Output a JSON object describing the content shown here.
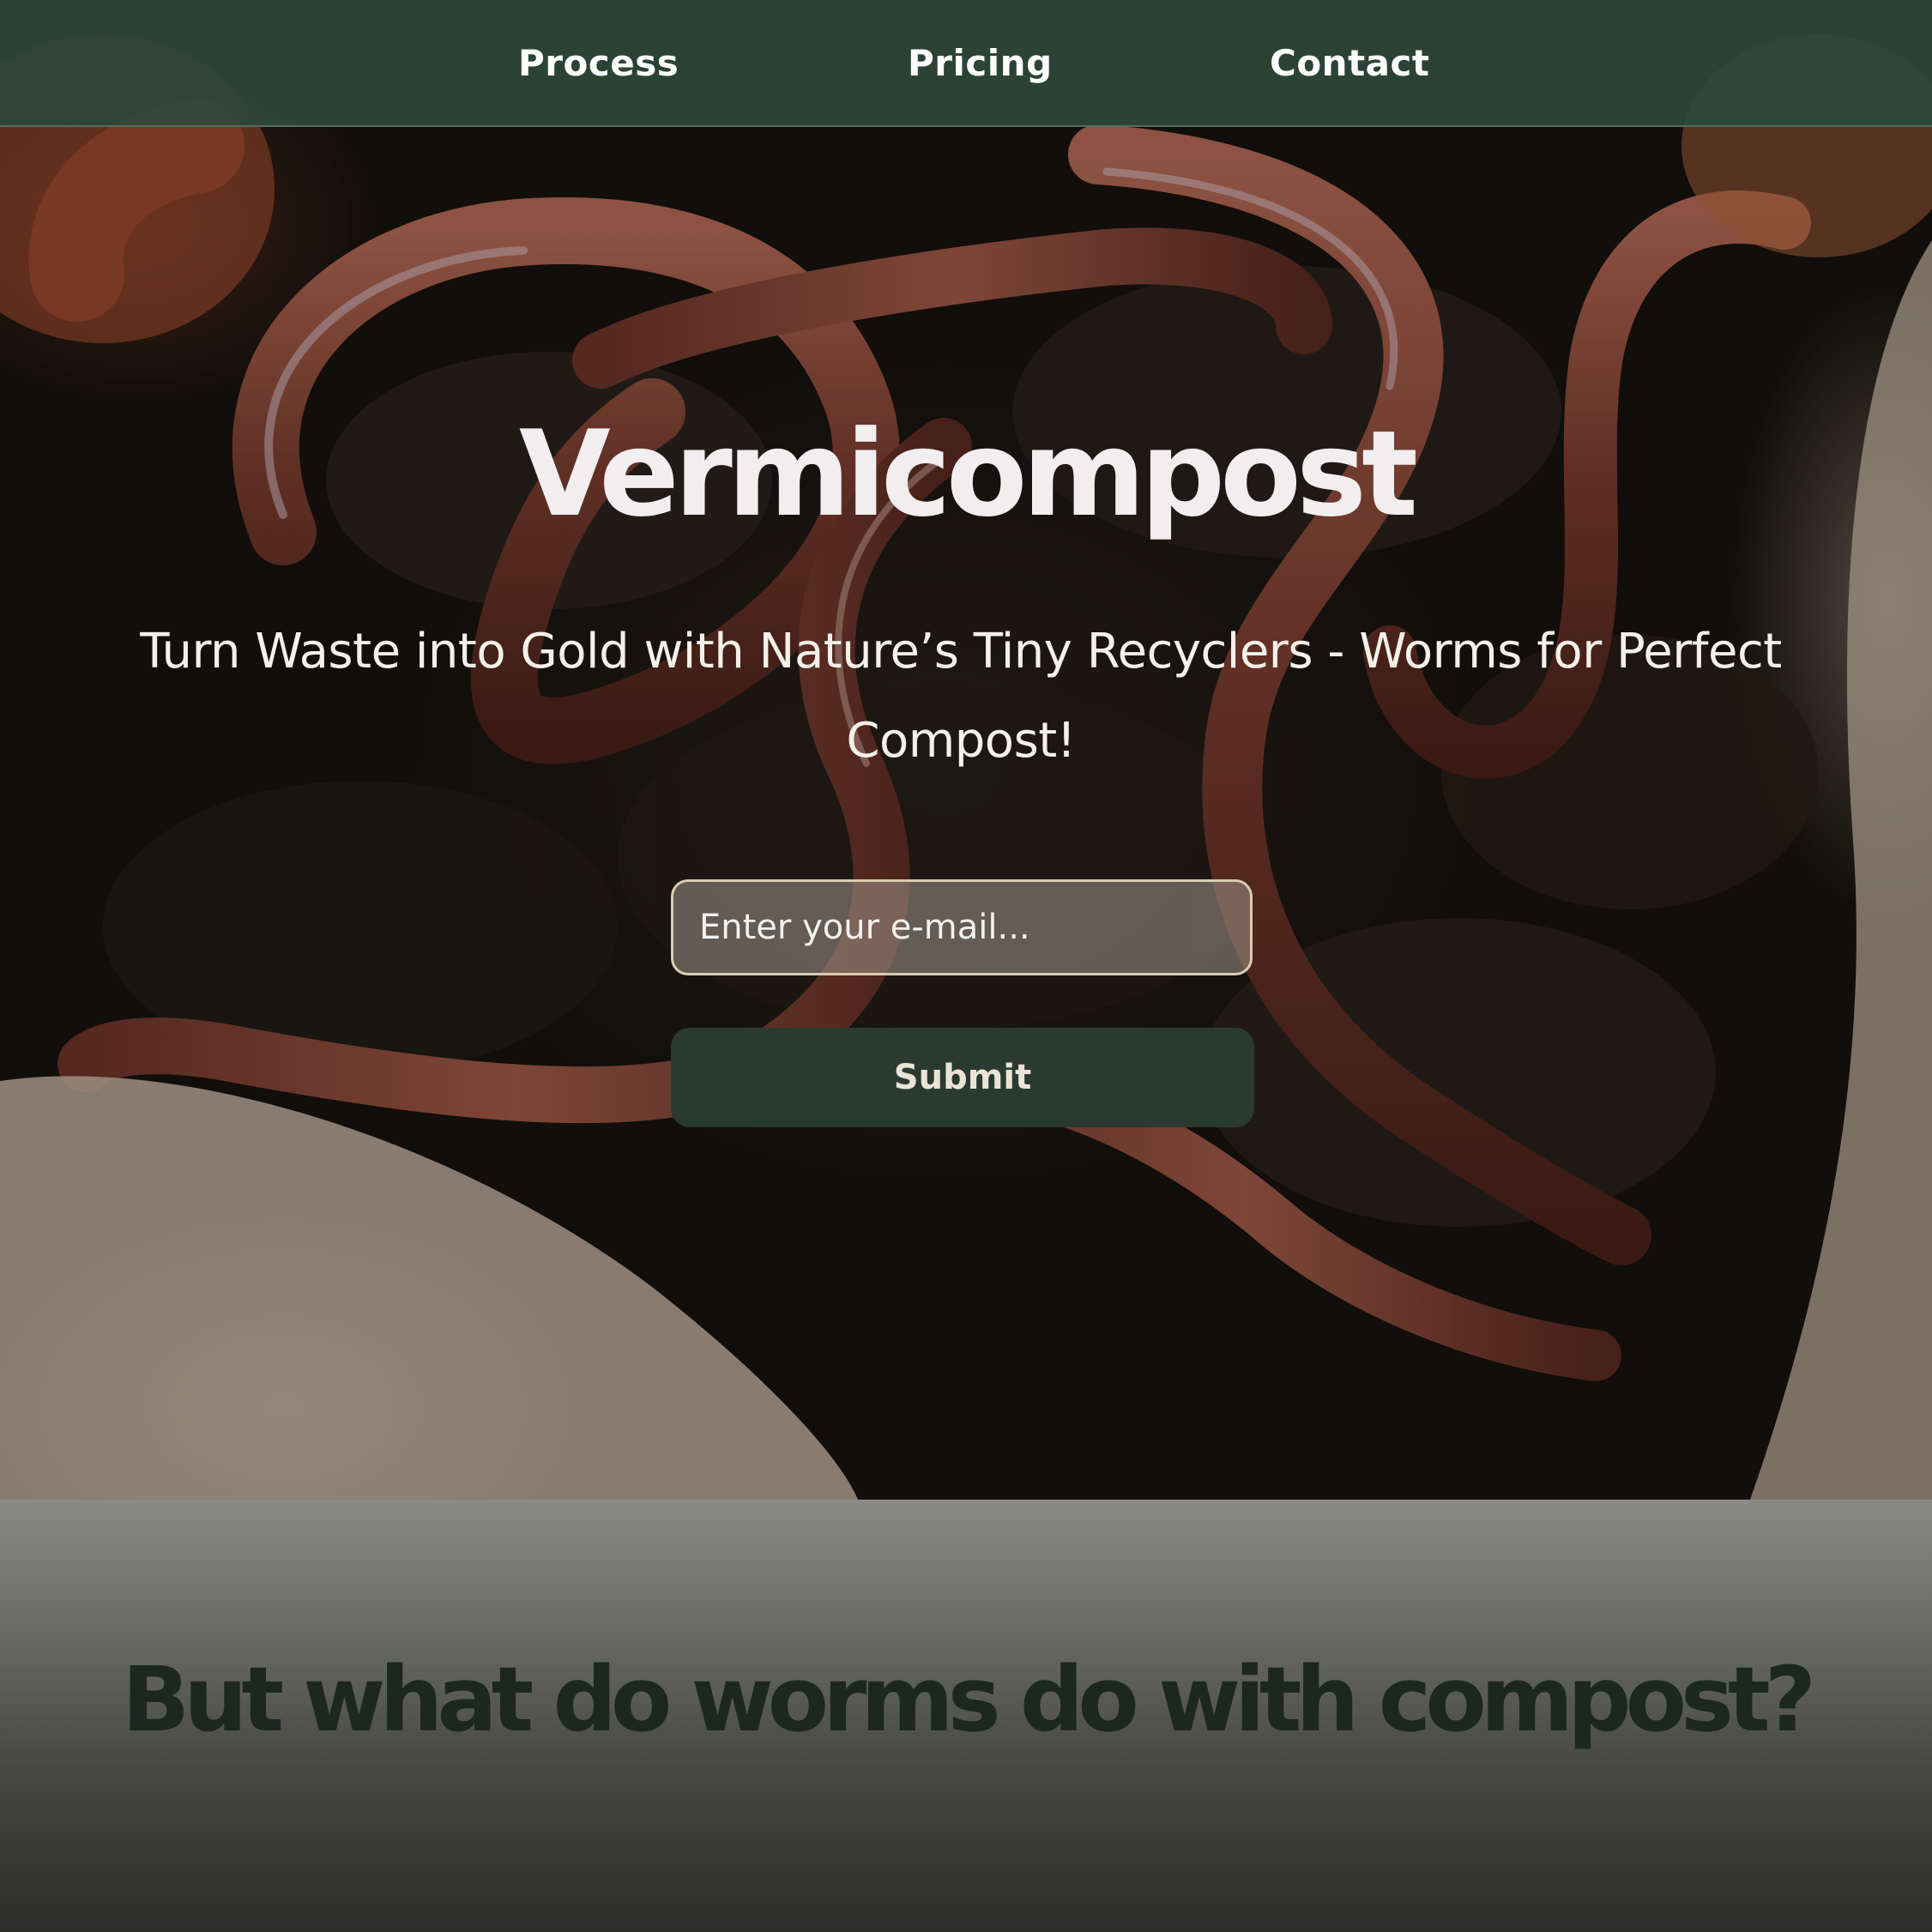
{
  "nav": {
    "items": [
      {
        "label": "Process"
      },
      {
        "label": "Pricing"
      },
      {
        "label": "Contact"
      }
    ]
  },
  "hero": {
    "title": "Vermicompost",
    "subtitle": "Turn Waste into Gold with Nature’s Tiny Recyclers - Worms for Perfect Compost!",
    "email_placeholder": "Enter your e-mail...",
    "email_value": "",
    "submit_label": "Submit",
    "background_image": "earthworms-in-soil"
  },
  "section_two": {
    "heading": "But what do worms do with compost?"
  },
  "colors": {
    "nav_background": "#2e483a",
    "submit_button": "#2a3a32",
    "input_border": "#d9cdb0",
    "heading_dark": "#1c2722",
    "worm": "#8a4a3a"
  }
}
